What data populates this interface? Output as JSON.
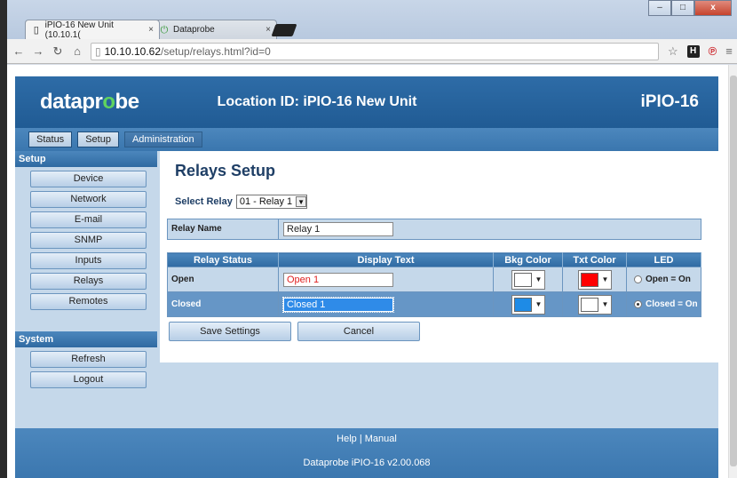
{
  "browser": {
    "tabs": [
      {
        "title": "iPIO-16 New Unit (10.10.1(",
        "close": "×"
      },
      {
        "title": "Dataprobe",
        "close": "×"
      }
    ],
    "url_host": "10.10.10.62",
    "url_path": "/setup/relays.html?id=0",
    "window_buttons": [
      "–",
      "□",
      "x"
    ]
  },
  "header": {
    "logo_pre": "datapr",
    "logo_mark": "o",
    "logo_post": "be",
    "location": "Location ID: iPIO-16 New Unit",
    "model": "iPIO-16"
  },
  "nav": {
    "tabs": [
      "Status",
      "Setup",
      "Administration"
    ]
  },
  "sidebar": {
    "setup_heading": "Setup",
    "setup_items": [
      "Device",
      "Network",
      "E-mail",
      "SNMP",
      "Inputs",
      "Relays",
      "Remotes"
    ],
    "system_heading": "System",
    "system_items": [
      "Refresh",
      "Logout"
    ]
  },
  "content": {
    "title": "Relays Setup",
    "select_label": "Select Relay",
    "select_value": "01 - Relay 1",
    "relay_name_label": "Relay Name",
    "relay_name_value": "Relay 1",
    "columns": [
      "Relay Status",
      "Display Text",
      "Bkg Color",
      "Txt Color",
      "LED"
    ],
    "rows": [
      {
        "status": "Open",
        "text": "Open 1",
        "bkg_color": "#ffffff",
        "txt_color": "#ff0000",
        "led": "Open = On"
      },
      {
        "status": "Closed",
        "text": "Closed 1",
        "bkg_color": "#1e8be6",
        "txt_color": "#ffffff",
        "led": "Closed = On"
      }
    ],
    "save_button": "Save Settings",
    "cancel_button": "Cancel"
  },
  "footer": {
    "links": "Help | Manual",
    "version": "Dataprobe iPIO-16 v2.00.068"
  },
  "colors": {
    "header_blue": "#2e6ca7",
    "accent_light": "#c5d8ea",
    "closed_row": "#6696c6"
  }
}
